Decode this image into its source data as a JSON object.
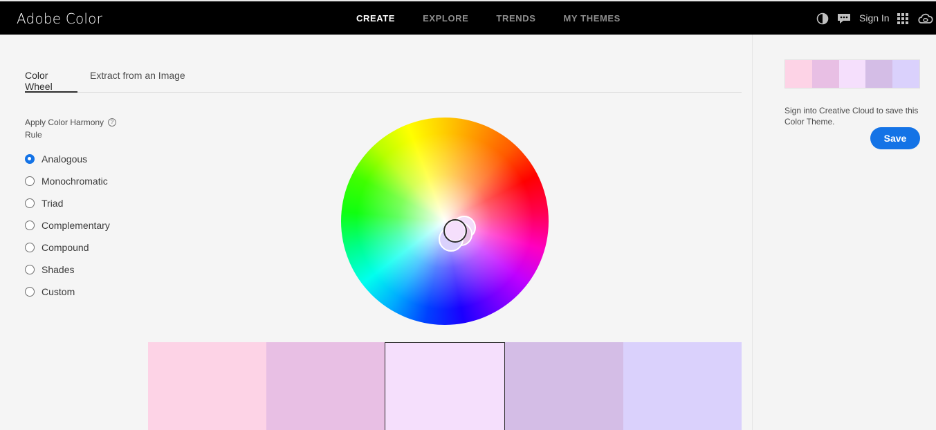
{
  "app": {
    "title": "Adobe Color"
  },
  "nav": {
    "items": [
      {
        "label": "CREATE",
        "active": true
      },
      {
        "label": "EXPLORE",
        "active": false
      },
      {
        "label": "TRENDS",
        "active": false
      },
      {
        "label": "MY THEMES",
        "active": false
      }
    ],
    "sign_in": "Sign In",
    "icons": [
      "contrast-icon",
      "feedback-icon",
      "apps-grid-icon",
      "creative-cloud-icon"
    ]
  },
  "tabs": [
    {
      "label": "Color Wheel",
      "active": true
    },
    {
      "label": "Extract from an Image",
      "active": false
    }
  ],
  "harmony": {
    "title": "Apply Color Harmony Rule",
    "help_icon": "?",
    "selected": "Analogous",
    "options": [
      "Analogous",
      "Monochromatic",
      "Triad",
      "Complementary",
      "Compound",
      "Shades",
      "Custom"
    ]
  },
  "theme": {
    "colors": [
      "#fdd3e6",
      "#e8bfe4",
      "#f5dffc",
      "#d4bde6",
      "#dad1fc"
    ],
    "selected_index": 2
  },
  "sidebar": {
    "message": "Sign into Creative Cloud to save this Color Theme.",
    "save_label": "Save"
  },
  "colors": {
    "accent": "#1473e6",
    "topbar": "#000000"
  }
}
